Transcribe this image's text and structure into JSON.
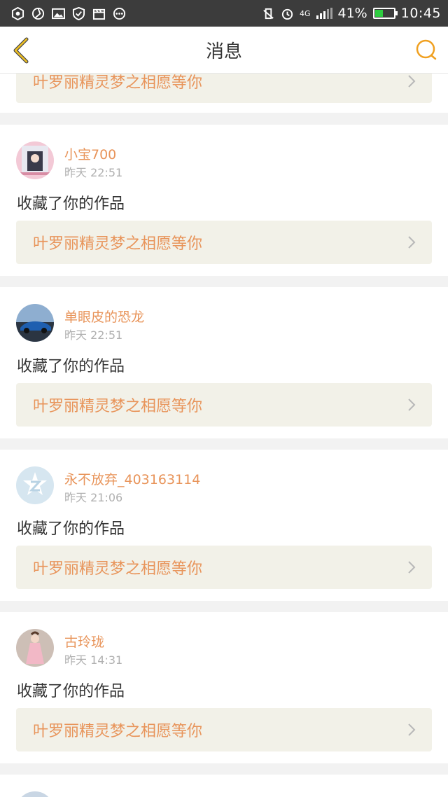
{
  "status_bar": {
    "network": "4G",
    "battery_percent": "41%",
    "battery_level": 0.41,
    "time": "10:45",
    "battery_color": "#2ecc40"
  },
  "header": {
    "title": "消息",
    "back_icon": "chevron-left-icon",
    "search_icon": "search-icon"
  },
  "accent_color": "#e8945a",
  "partial_item": {
    "link_text": "叶罗丽精灵梦之相愿等你"
  },
  "messages": [
    {
      "user": "小宝700",
      "time": "昨天 22:51",
      "action": "收藏了你的作品",
      "link_text": "叶罗丽精灵梦之相愿等你"
    },
    {
      "user": "单眼皮的恐龙",
      "time": "昨天 22:51",
      "action": "收藏了你的作品",
      "link_text": "叶罗丽精灵梦之相愿等你"
    },
    {
      "user": "永不放弃_403163114",
      "time": "昨天 21:06",
      "action": "收藏了你的作品",
      "link_text": "叶罗丽精灵梦之相愿等你"
    },
    {
      "user": "古玲珑",
      "time": "昨天 14:31",
      "action": "收藏了你的作品",
      "link_text": "叶罗丽精灵梦之相愿等你"
    }
  ]
}
